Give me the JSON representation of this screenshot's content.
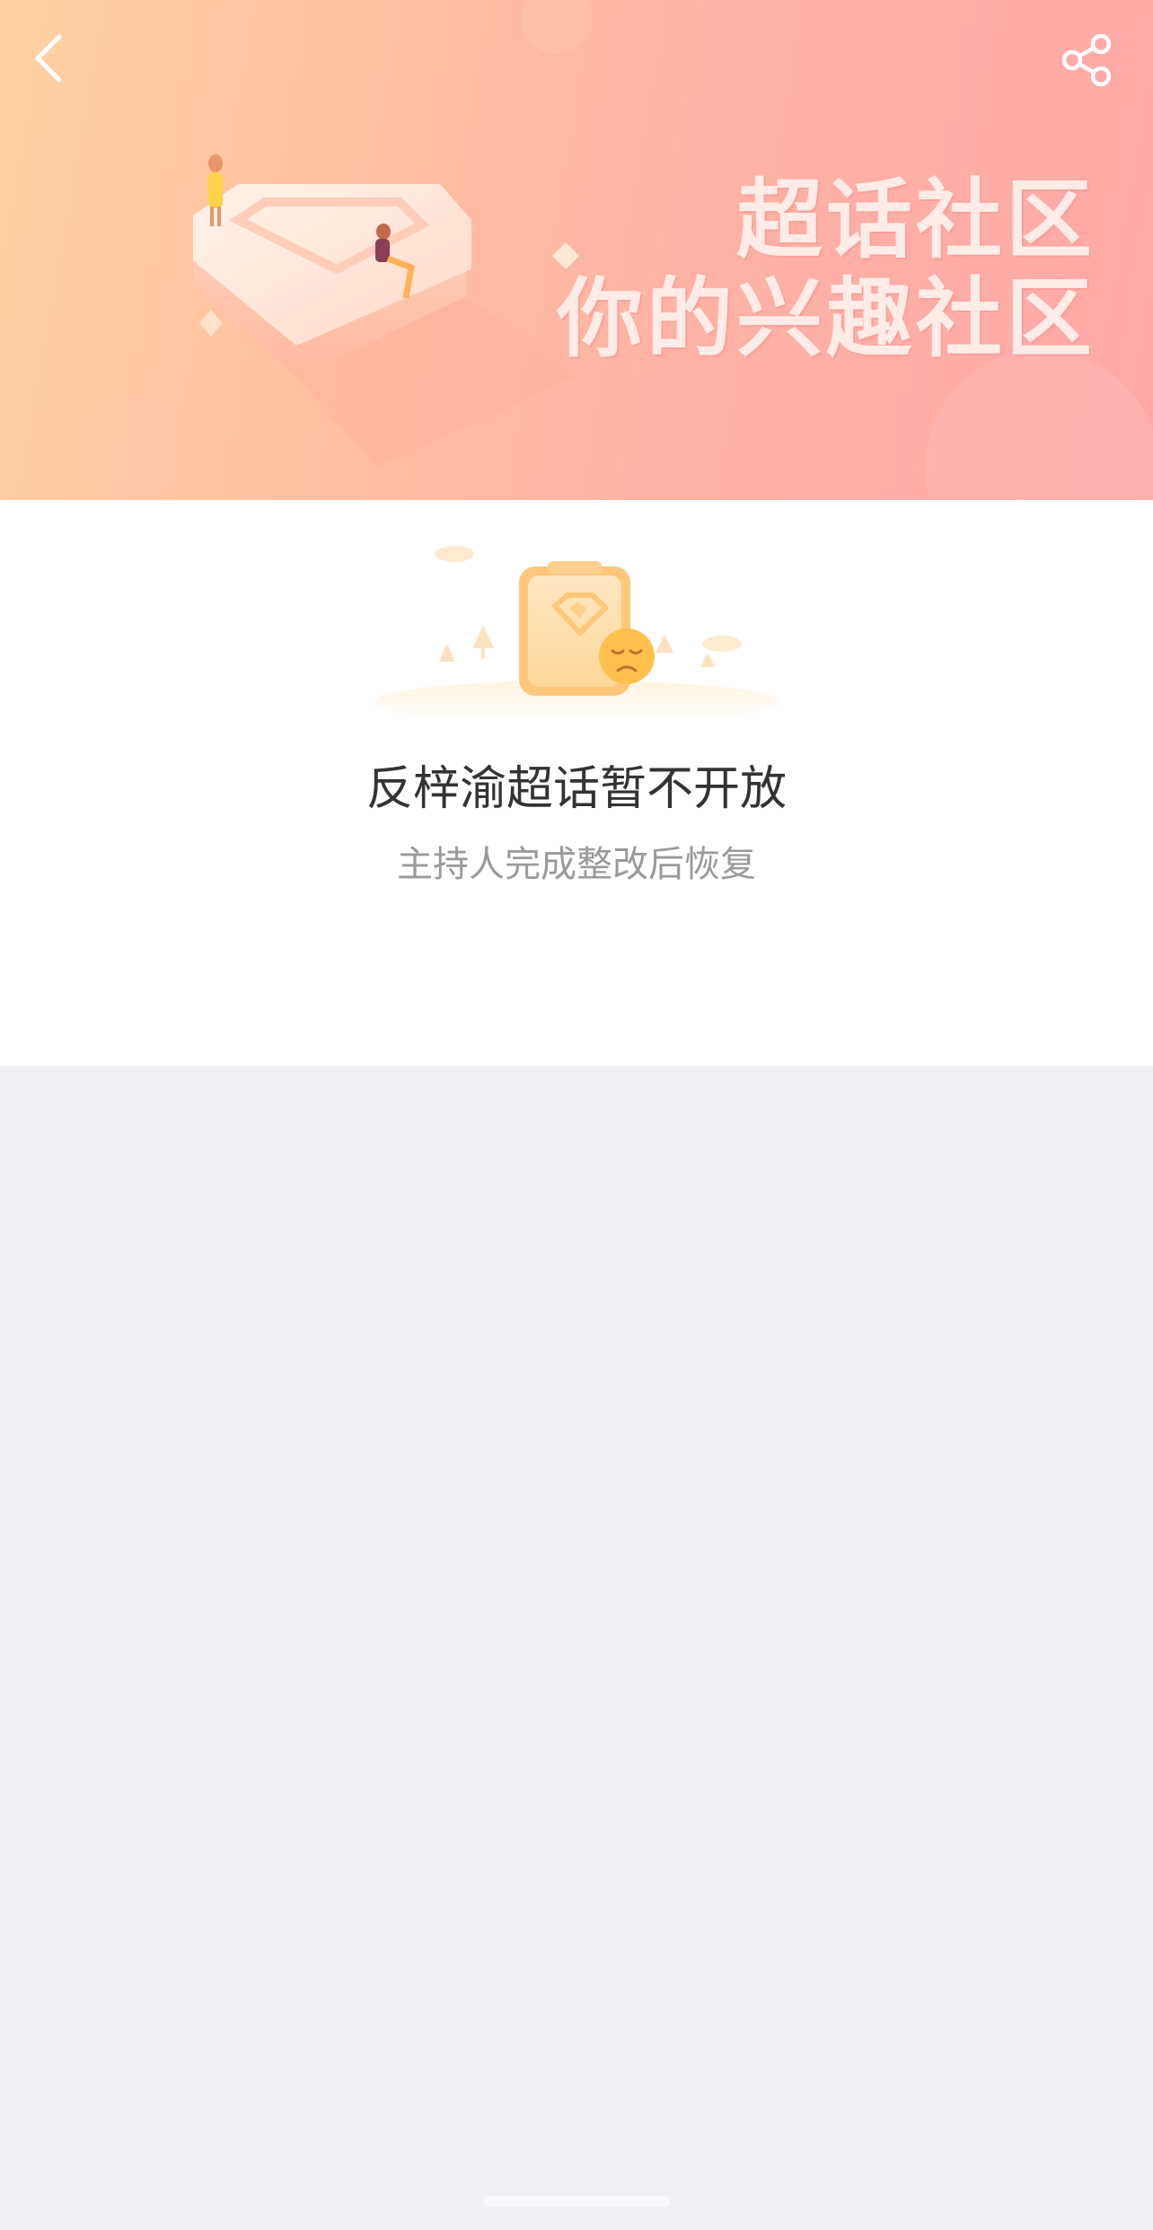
{
  "header": {
    "back_icon": "chevron-left-icon",
    "share_icon": "share-icon",
    "icon_color": "#ffffff"
  },
  "banner": {
    "slogan_line1": "超话社区",
    "slogan_line2": "你的兴趣社区",
    "gradient_start": "#ffd2a2",
    "gradient_end": "#ffa8a8"
  },
  "notice": {
    "illustration_icon": "closed-supertopic-clipboard-icon",
    "title": "反梓渝超话暂不开放",
    "subtitle": "主持人完成整改后恢复",
    "title_color": "#333333",
    "subtitle_color": "#9a9a9a"
  },
  "page": {
    "background": "#f0f0f4"
  }
}
